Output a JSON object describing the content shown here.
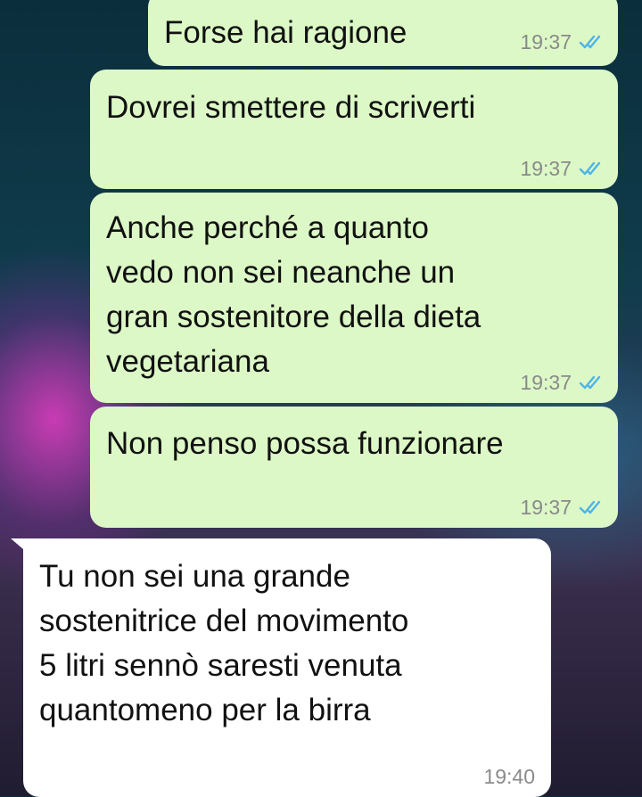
{
  "messages": [
    {
      "direction": "out",
      "text": "Forse hai ragione",
      "time": "19:37",
      "status": "read"
    },
    {
      "direction": "out",
      "text": "Dovrei smettere di scriverti",
      "time": "19:37",
      "status": "read"
    },
    {
      "direction": "out",
      "text": "Anche perché a quanto\nvedo non sei neanche un\ngran sostenitore della dieta\nvegetariana",
      "time": "19:37",
      "status": "read"
    },
    {
      "direction": "out",
      "text": "Non penso possa funzionare",
      "time": "19:37",
      "status": "read"
    },
    {
      "direction": "in",
      "text": "Tu non sei una grande\nsostenitrice del movimento\n5 litri sennò saresti venuta\nquantomeno per la birra",
      "time": "19:40"
    }
  ],
  "colors": {
    "outgoing_bubble": "#dcf8c6",
    "incoming_bubble": "#ffffff",
    "read_ticks": "#4fb4e8",
    "timestamp": "#8a8a8a"
  },
  "icons": {
    "read_status": "double-check-icon"
  }
}
